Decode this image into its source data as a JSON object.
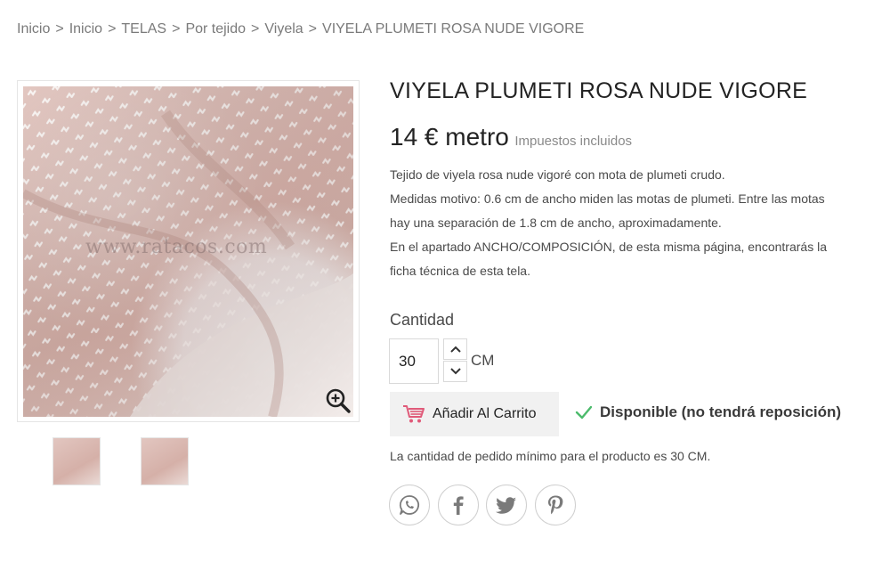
{
  "breadcrumb": {
    "items": [
      "Inicio",
      "Inicio",
      "TELAS",
      "Por tejido",
      "Viyela",
      "VIYELA PLUMETI ROSA NUDE VIGORE"
    ],
    "separator": ">"
  },
  "gallery": {
    "watermark": "www.ratacos.com",
    "main_image": "pink-plumeti-fabric-photo",
    "thumbnails": [
      "fabric-thumbnail-1",
      "fabric-thumbnail-2"
    ]
  },
  "product": {
    "title": "VIYELA PLUMETI ROSA NUDE VIGORE",
    "price": "14 € metro",
    "tax_note": "Impuestos incluidos",
    "description": [
      "Tejido de viyela rosa nude vigoré con mota de plumeti crudo.",
      "Medidas motivo: 0.6 cm de ancho miden las motas de plumeti. Entre las motas",
      "hay una separación de 1.8 cm de ancho, aproximadamente.",
      "En el apartado ANCHO/COMPOSICIÓN, de esta misma página, encontrarás la",
      "ficha técnica de esta tela."
    ]
  },
  "quantity": {
    "label": "Cantidad",
    "value": "30",
    "unit": "CM"
  },
  "cart": {
    "button_label": "Añadir Al Carrito",
    "icon_color": "#e05a79"
  },
  "availability": {
    "text": "Disponible (no tendrá reposición)",
    "check_color": "#4cbb6c"
  },
  "min_quantity_note": "La cantidad de pedido mínimo para el producto es 30 CM.",
  "share": {
    "icons": [
      "whatsapp-icon",
      "facebook-icon",
      "twitter-icon",
      "pinterest-icon"
    ]
  }
}
